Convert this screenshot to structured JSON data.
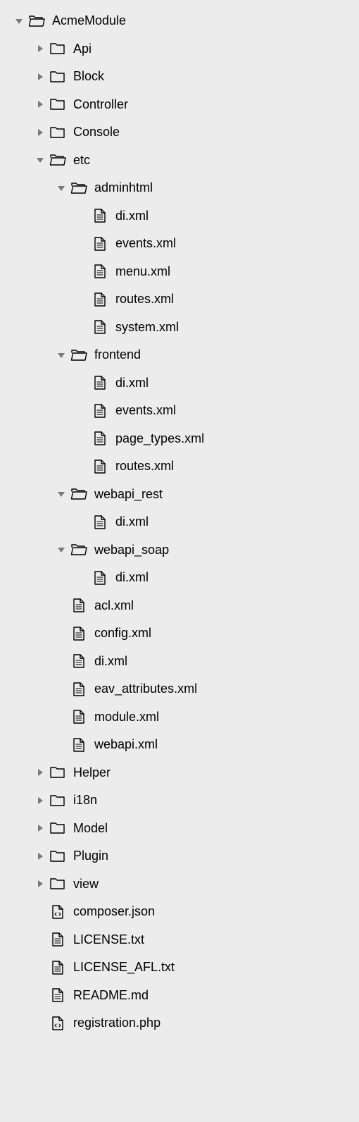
{
  "tree": [
    {
      "depth": 0,
      "expand": "open",
      "type": "folder-open",
      "label": "AcmeModule"
    },
    {
      "depth": 1,
      "expand": "closed",
      "type": "folder-closed",
      "label": "Api"
    },
    {
      "depth": 1,
      "expand": "closed",
      "type": "folder-closed",
      "label": "Block"
    },
    {
      "depth": 1,
      "expand": "closed",
      "type": "folder-closed",
      "label": "Controller"
    },
    {
      "depth": 1,
      "expand": "closed",
      "type": "folder-closed",
      "label": "Console"
    },
    {
      "depth": 1,
      "expand": "open",
      "type": "folder-open",
      "label": "etc"
    },
    {
      "depth": 2,
      "expand": "open",
      "type": "folder-open",
      "label": "adminhtml"
    },
    {
      "depth": 3,
      "expand": "none",
      "type": "file-list",
      "label": "di.xml"
    },
    {
      "depth": 3,
      "expand": "none",
      "type": "file-list",
      "label": "events.xml"
    },
    {
      "depth": 3,
      "expand": "none",
      "type": "file-list",
      "label": "menu.xml"
    },
    {
      "depth": 3,
      "expand": "none",
      "type": "file-list",
      "label": "routes.xml"
    },
    {
      "depth": 3,
      "expand": "none",
      "type": "file-list",
      "label": "system.xml"
    },
    {
      "depth": 2,
      "expand": "open",
      "type": "folder-open",
      "label": "frontend"
    },
    {
      "depth": 3,
      "expand": "none",
      "type": "file-list",
      "label": "di.xml"
    },
    {
      "depth": 3,
      "expand": "none",
      "type": "file-list",
      "label": "events.xml"
    },
    {
      "depth": 3,
      "expand": "none",
      "type": "file-list",
      "label": "page_types.xml"
    },
    {
      "depth": 3,
      "expand": "none",
      "type": "file-list",
      "label": "routes.xml"
    },
    {
      "depth": 2,
      "expand": "open",
      "type": "folder-open",
      "label": "webapi_rest"
    },
    {
      "depth": 3,
      "expand": "none",
      "type": "file-list",
      "label": "di.xml"
    },
    {
      "depth": 2,
      "expand": "open",
      "type": "folder-open",
      "label": "webapi_soap"
    },
    {
      "depth": 3,
      "expand": "none",
      "type": "file-list",
      "label": "di.xml"
    },
    {
      "depth": 2,
      "expand": "none",
      "type": "file-list",
      "label": "acl.xml"
    },
    {
      "depth": 2,
      "expand": "none",
      "type": "file-list",
      "label": "config.xml"
    },
    {
      "depth": 2,
      "expand": "none",
      "type": "file-list",
      "label": "di.xml"
    },
    {
      "depth": 2,
      "expand": "none",
      "type": "file-list",
      "label": "eav_attributes.xml"
    },
    {
      "depth": 2,
      "expand": "none",
      "type": "file-list",
      "label": "module.xml"
    },
    {
      "depth": 2,
      "expand": "none",
      "type": "file-list",
      "label": "webapi.xml"
    },
    {
      "depth": 1,
      "expand": "closed",
      "type": "folder-closed",
      "label": "Helper"
    },
    {
      "depth": 1,
      "expand": "closed",
      "type": "folder-closed",
      "label": "i18n"
    },
    {
      "depth": 1,
      "expand": "closed",
      "type": "folder-closed",
      "label": "Model"
    },
    {
      "depth": 1,
      "expand": "closed",
      "type": "folder-closed",
      "label": "Plugin"
    },
    {
      "depth": 1,
      "expand": "closed",
      "type": "folder-closed",
      "label": "view"
    },
    {
      "depth": 1,
      "expand": "none",
      "type": "file-code",
      "label": "composer.json"
    },
    {
      "depth": 1,
      "expand": "none",
      "type": "file-list",
      "label": "LICENSE.txt"
    },
    {
      "depth": 1,
      "expand": "none",
      "type": "file-list",
      "label": "LICENSE_AFL.txt"
    },
    {
      "depth": 1,
      "expand": "none",
      "type": "file-list",
      "label": "README.md"
    },
    {
      "depth": 1,
      "expand": "none",
      "type": "file-code",
      "label": "registration.php"
    }
  ]
}
